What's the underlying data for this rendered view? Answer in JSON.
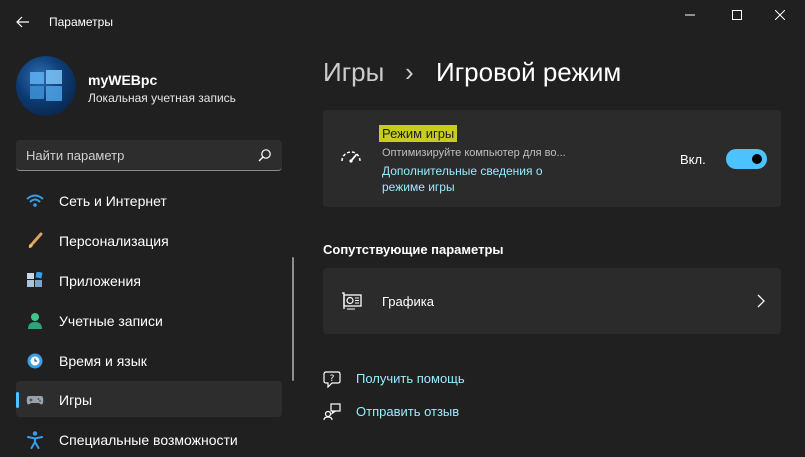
{
  "window": {
    "title": "Параметры",
    "controls": [
      "minimize-icon",
      "maximize-icon",
      "close-icon"
    ]
  },
  "profile": {
    "name": "myWEBpc",
    "account_type": "Локальная учетная запись"
  },
  "search": {
    "placeholder": "Найти параметр",
    "icon": "search-icon"
  },
  "sidebar": {
    "items": [
      {
        "label": "Сеть и Интернет",
        "icon": "wifi-icon",
        "active": false
      },
      {
        "label": "Персонализация",
        "icon": "brush-icon",
        "active": false
      },
      {
        "label": "Приложения",
        "icon": "apps-icon",
        "active": false
      },
      {
        "label": "Учетные записи",
        "icon": "person-icon",
        "active": false
      },
      {
        "label": "Время и язык",
        "icon": "globe-clock-icon",
        "active": false
      },
      {
        "label": "Игры",
        "icon": "gamepad-icon",
        "active": true
      },
      {
        "label": "Специальные возможности",
        "icon": "accessibility-icon",
        "active": false
      }
    ]
  },
  "breadcrumb": {
    "parent": "Игры",
    "separator": "›",
    "current": "Игровой режим"
  },
  "game_mode_card": {
    "title": "Режим игры",
    "description": "Оптимизируйте компьютер для во...",
    "link": "Дополнительные сведения о режиме игры",
    "toggle_label": "Вкл.",
    "toggle_on": true,
    "icon": "speedometer-icon"
  },
  "related": {
    "title": "Сопутствующие параметры",
    "items": [
      {
        "label": "Графика",
        "icon": "graphics-card-icon"
      }
    ]
  },
  "help_links": [
    {
      "label": "Получить помощь",
      "icon": "help-icon"
    },
    {
      "label": "Отправить отзыв",
      "icon": "feedback-icon"
    }
  ],
  "colors": {
    "background": "#202020",
    "card": "#2b2b2b",
    "accent": "#4cc2ff",
    "link": "#99ebff",
    "highlight": "#f5f530"
  }
}
